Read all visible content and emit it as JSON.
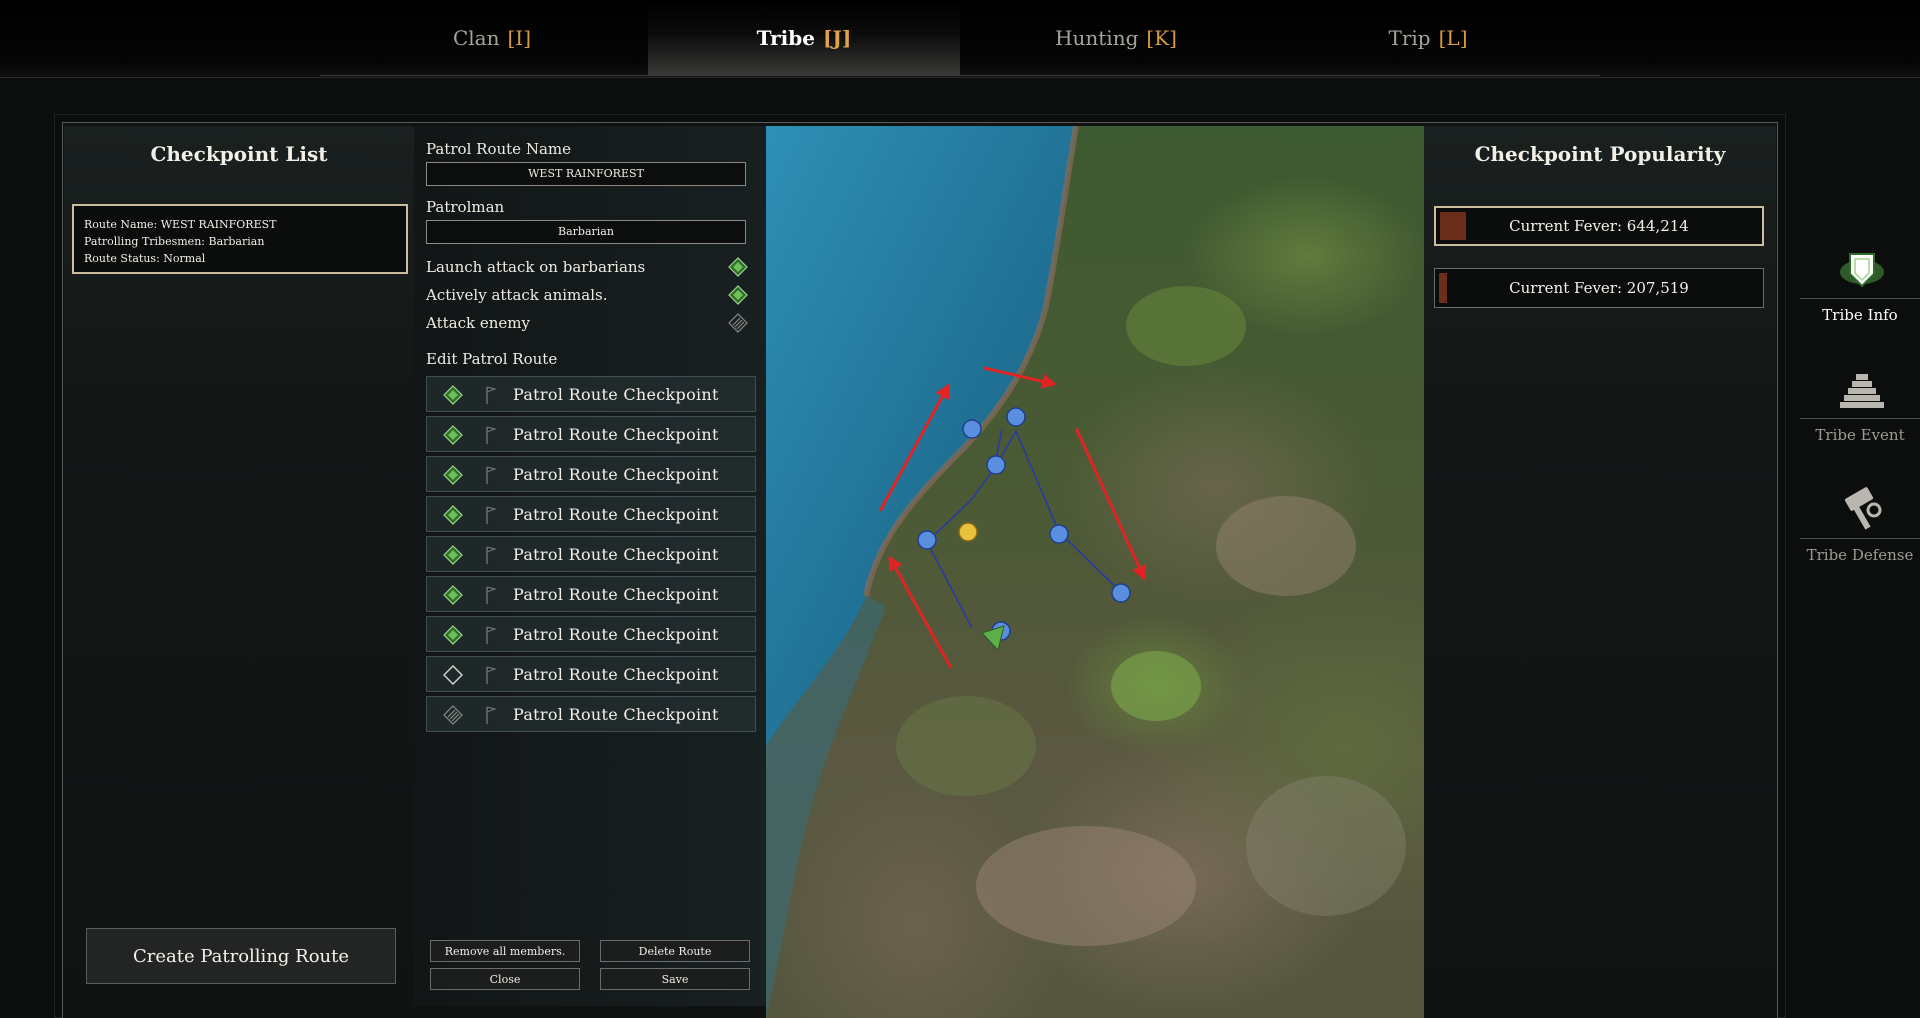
{
  "tabs": [
    {
      "label": "Clan",
      "key": "[I]"
    },
    {
      "label": "Tribe",
      "key": "[J]"
    },
    {
      "label": "Hunting",
      "key": "[K]"
    },
    {
      "label": "Trip",
      "key": "[L]"
    }
  ],
  "active_tab": "Tribe",
  "checkpoint_list": {
    "title": "Checkpoint List",
    "route_card": {
      "name_line": "Route Name: WEST RAINFOREST",
      "tribesmen_line": "Patrolling Tribesmen: Barbarian",
      "status_line": "Route Status: Normal"
    },
    "create_button": "Create Patrolling Route"
  },
  "edit": {
    "route_name_label": "Patrol Route Name",
    "route_name_value": "WEST RAINFOREST",
    "patrolman_label": "Patrolman",
    "patrolman_value": "Barbarian",
    "options": [
      {
        "label": "Launch attack on barbarians",
        "state": "on"
      },
      {
        "label": "Actively attack animals.",
        "state": "on"
      },
      {
        "label": "Attack enemy",
        "state": "disabled"
      }
    ],
    "edit_route_label": "Edit Patrol Route",
    "checkpoints": [
      {
        "label": "Patrol Route Checkpoint",
        "state": "active"
      },
      {
        "label": "Patrol Route Checkpoint",
        "state": "active"
      },
      {
        "label": "Patrol Route Checkpoint",
        "state": "active"
      },
      {
        "label": "Patrol Route Checkpoint",
        "state": "active"
      },
      {
        "label": "Patrol Route Checkpoint",
        "state": "active"
      },
      {
        "label": "Patrol Route Checkpoint",
        "state": "active"
      },
      {
        "label": "Patrol Route Checkpoint",
        "state": "active"
      },
      {
        "label": "Patrol Route Checkpoint",
        "state": "empty"
      },
      {
        "label": "Patrol Route Checkpoint",
        "state": "disabled"
      }
    ],
    "buttons": {
      "remove_all": "Remove all members.",
      "delete_route": "Delete Route",
      "close": "Close",
      "save": "Save"
    }
  },
  "popularity": {
    "title": "Checkpoint Popularity",
    "entries": [
      {
        "label": "Current Fever: 644,214",
        "fill": 0.08
      },
      {
        "label": "Current Fever: 207,519",
        "fill": 0.025
      }
    ]
  },
  "side_nav": [
    {
      "label": "Tribe Info",
      "icon": "shield-icon"
    },
    {
      "label": "Tribe Event",
      "icon": "pyramid-icon"
    },
    {
      "label": "Tribe Defense",
      "icon": "hammer-icon"
    }
  ],
  "colors": {
    "accent_key": "#d99a43",
    "selected_border": "#c9bf9e",
    "checkpoint_blue": "#5a8fe0",
    "route_line": "#2b3aa0",
    "arrow_red": "#e02424",
    "marker_yellow": "#e8c23a",
    "toggle_green": "#5fae4a",
    "fever_bar": "#6b2e1c"
  }
}
